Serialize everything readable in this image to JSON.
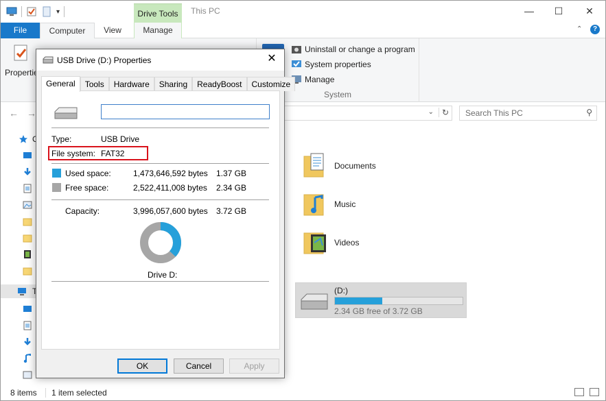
{
  "titlebar": {
    "contextual_tab": "Drive Tools",
    "window_title": "This PC",
    "minimize": "—",
    "maximize": "☐",
    "close": "✕"
  },
  "ribbon": {
    "tabs": {
      "file": "File",
      "computer": "Computer",
      "view": "View",
      "manage": "Manage"
    },
    "properties_label": "Propertie",
    "system_group": {
      "uninstall": "Uninstall or change a program",
      "system_properties": "System properties",
      "manage": "Manage",
      "label": "System"
    }
  },
  "address": {
    "search_placeholder": "Search This PC"
  },
  "nav_pane": {
    "quick_access_letter": "C",
    "this_pc_letter": "T"
  },
  "content": {
    "folders": [
      {
        "label": "Documents"
      },
      {
        "label": "Music"
      },
      {
        "label": "Videos"
      }
    ],
    "drive": {
      "name": "(D:)",
      "free_text": "2.34 GB free of 3.72 GB",
      "used_fraction": 0.37
    }
  },
  "statusbar": {
    "items": "8 items",
    "selected": "1 item selected"
  },
  "dialog": {
    "title": "USB Drive (D:) Properties",
    "tabs": [
      "General",
      "Tools",
      "Hardware",
      "Sharing",
      "ReadyBoost",
      "Customize"
    ],
    "name_value": "",
    "type_label": "Type:",
    "type_value": "USB Drive",
    "fs_label": "File system:",
    "fs_value": "FAT32",
    "used_label": "Used space:",
    "used_bytes": "1,473,646,592 bytes",
    "used_gb": "1.37 GB",
    "free_label": "Free space:",
    "free_bytes": "2,522,411,008 bytes",
    "free_gb": "2.34 GB",
    "capacity_label": "Capacity:",
    "capacity_bytes": "3,996,057,600 bytes",
    "capacity_gb": "3.72 GB",
    "drive_label": "Drive D:",
    "used_fraction": 0.369,
    "colors": {
      "used": "#26a0da",
      "free": "#a6a6a6",
      "highlight": "#d9121b"
    },
    "buttons": {
      "ok": "OK",
      "cancel": "Cancel",
      "apply": "Apply"
    }
  }
}
